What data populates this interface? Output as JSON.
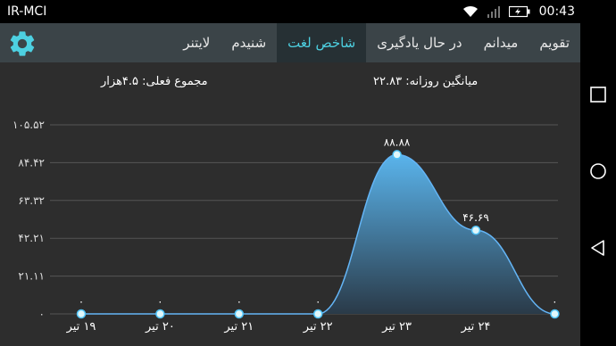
{
  "status_bar": {
    "carrier": "IR-MCI",
    "time": "00:43",
    "icons": [
      "wifi-icon",
      "signal-icon",
      "battery-charging-icon"
    ]
  },
  "tabs": [
    {
      "label": "تقویم",
      "active": false
    },
    {
      "label": "میدانم",
      "active": false
    },
    {
      "label": "در حال یادگیری",
      "active": false
    },
    {
      "label": "شاخص لغت",
      "active": true
    },
    {
      "label": "شنیدم",
      "active": false
    },
    {
      "label": "لایتنر",
      "active": false
    }
  ],
  "settings_icon": "gear-icon",
  "summary": {
    "daily_average": "میانگین روزانه: ۲۲.۸۳",
    "current_total": "مجموع فعلی: ۴.۵هزار"
  },
  "colors": {
    "accent": "#4dd0e1",
    "chart_fill_top": "#5ab4ec",
    "chart_line": "#64b5f6",
    "tab_bar": "#3b4448",
    "background": "#2d2d2d"
  },
  "chart_data": {
    "type": "area",
    "categories": [
      "۱۹ تیر",
      "۲۰ تیر",
      "۲۱ تیر",
      "۲۲ تیر",
      "۲۳ تیر",
      "۲۴ تیر",
      ""
    ],
    "values": [
      0,
      0,
      0,
      0,
      88.88,
      46.69,
      0
    ],
    "point_labels": [
      "۰",
      "۰",
      "۰",
      "۰",
      "۸۸.۸۸",
      "۴۶.۶۹",
      "۰"
    ],
    "y_ticks": [
      "۰",
      "۲۱.۱۱",
      "۴۲.۲۱",
      "۶۳.۳۲",
      "۸۴.۴۲",
      "۱۰۵.۵۲"
    ],
    "y_tick_values": [
      0,
      21.11,
      42.21,
      63.32,
      84.42,
      105.52
    ],
    "ylim": [
      0,
      105.52
    ],
    "grid": true
  },
  "nav_bar": {
    "buttons": [
      "recent-apps",
      "home",
      "back"
    ]
  }
}
